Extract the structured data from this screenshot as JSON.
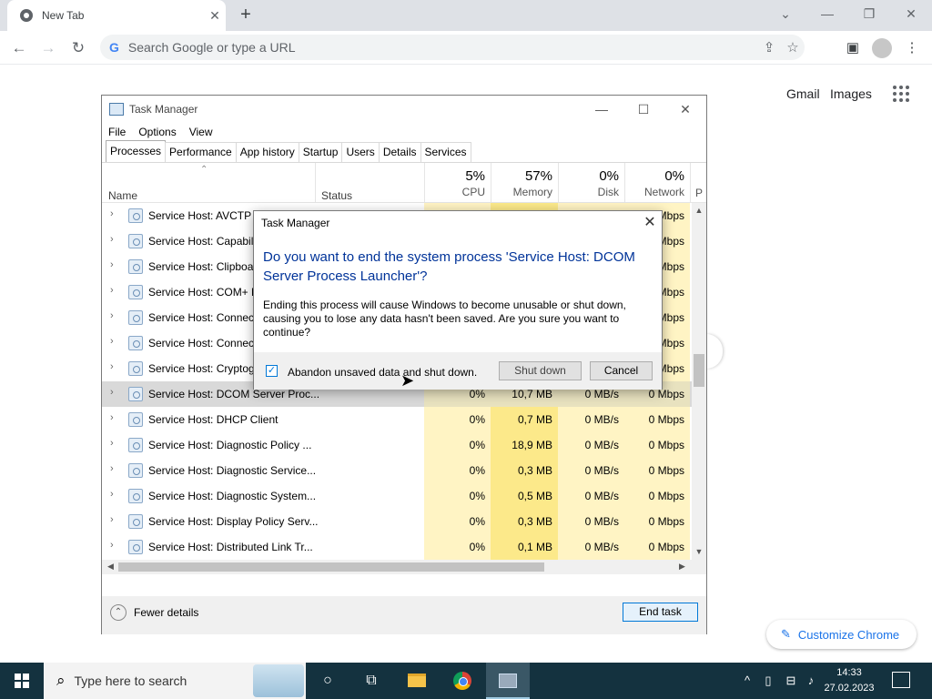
{
  "browser": {
    "tab_title": "New Tab",
    "tab_close": "✕",
    "new_tab": "+",
    "omnibox_placeholder": "Search Google or type a URL",
    "ntp_links": [
      "Gmail",
      "Images"
    ],
    "customize_label": "Customize Chrome"
  },
  "task_manager": {
    "title": "Task Manager",
    "menu": [
      "File",
      "Options",
      "View"
    ],
    "tabs": [
      "Processes",
      "Performance",
      "App history",
      "Startup",
      "Users",
      "Details",
      "Services"
    ],
    "active_tab": "Processes",
    "headers": {
      "name": "Name",
      "status": "Status",
      "cpu_pct": "5%",
      "cpu": "CPU",
      "memory_pct": "57%",
      "memory": "Memory",
      "disk_pct": "0%",
      "disk": "Disk",
      "network_pct": "0%",
      "network": "Network",
      "power_initial": "P"
    },
    "rows": [
      {
        "name": "Service Host: AVCTP s",
        "cpu": "",
        "memory": "",
        "disk": "",
        "net": "Mbps"
      },
      {
        "name": "Service Host: Capabili",
        "cpu": "",
        "memory": "",
        "disk": "",
        "net": "Mbps"
      },
      {
        "name": "Service Host: Clipboar",
        "cpu": "",
        "memory": "",
        "disk": "",
        "net": "Mbps"
      },
      {
        "name": "Service Host: COM+ E",
        "cpu": "",
        "memory": "",
        "disk": "",
        "net": "Mbps"
      },
      {
        "name": "Service Host: Connect",
        "cpu": "",
        "memory": "",
        "disk": "",
        "net": "Mbps"
      },
      {
        "name": "Service Host: Connect",
        "cpu": "",
        "memory": "",
        "disk": "",
        "net": "Mbps"
      },
      {
        "name": "Service Host: Cryptogr",
        "cpu": "",
        "memory": "",
        "disk": "",
        "net": "Mbps"
      },
      {
        "name": "Service Host: DCOM Server Proc...",
        "cpu": "0%",
        "memory": "10,7 MB",
        "disk": "0 MB/s",
        "net": "0 Mbps"
      },
      {
        "name": "Service Host: DHCP Client",
        "cpu": "0%",
        "memory": "0,7 MB",
        "disk": "0 MB/s",
        "net": "0 Mbps"
      },
      {
        "name": "Service Host: Diagnostic Policy ...",
        "cpu": "0%",
        "memory": "18,9 MB",
        "disk": "0 MB/s",
        "net": "0 Mbps"
      },
      {
        "name": "Service Host: Diagnostic Service...",
        "cpu": "0%",
        "memory": "0,3 MB",
        "disk": "0 MB/s",
        "net": "0 Mbps"
      },
      {
        "name": "Service Host: Diagnostic System...",
        "cpu": "0%",
        "memory": "0,5 MB",
        "disk": "0 MB/s",
        "net": "0 Mbps"
      },
      {
        "name": "Service Host: Display Policy Serv...",
        "cpu": "0%",
        "memory": "0,3 MB",
        "disk": "0 MB/s",
        "net": "0 Mbps"
      },
      {
        "name": "Service Host: Distributed Link Tr...",
        "cpu": "0%",
        "memory": "0,1 MB",
        "disk": "0 MB/s",
        "net": "0 Mbps"
      }
    ],
    "fewer_details": "Fewer details",
    "end_task": "End task"
  },
  "dialog": {
    "title": "Task Manager",
    "question": "Do you want to end the system process 'Service Host: DCOM Server Process Launcher'?",
    "body": "Ending this process will cause Windows to become unusable or shut down, causing you to lose any data hasn't been saved. Are you sure you want to continue?",
    "checkbox_label": "Abandon unsaved data and shut down.",
    "checkbox_checked": true,
    "shutdown_label": "Shut down",
    "cancel_label": "Cancel"
  },
  "taskbar": {
    "search_placeholder": "Type here to search",
    "time": "14:33",
    "date": "27.02.2023"
  }
}
